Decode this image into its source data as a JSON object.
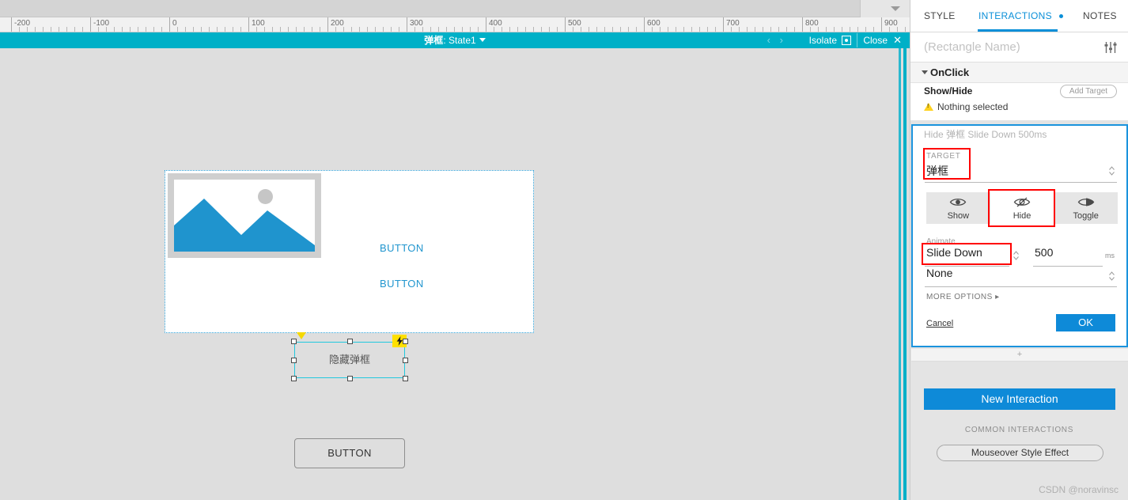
{
  "canvas_toolbar": {
    "ruler_labels": [
      "-200",
      "-100",
      "0",
      "100",
      "200",
      "300",
      "400",
      "500",
      "600",
      "700",
      "800",
      "900"
    ],
    "collapse_icon": "chevron-down-icon"
  },
  "isolate_bar": {
    "widget_name": "弹框",
    "state_separator": ": ",
    "state_name": "State1",
    "prev": "‹",
    "next": "›",
    "isolate_label": "Isolate",
    "close_label": "Close",
    "close_x": "✕"
  },
  "canvas": {
    "dialog": {
      "links": [
        "BUTTON",
        "BUTTON"
      ],
      "image_placeholder_icon": "image-placeholder-icon"
    },
    "selected_shape": {
      "label": "隐藏弹框",
      "bolt_icon": "lightning-bolt-icon",
      "rotate_icon": "rotate-handle-icon"
    },
    "bottom_button": {
      "label": "BUTTON"
    }
  },
  "right_panel": {
    "tabs": [
      {
        "label": "STYLE",
        "active": false
      },
      {
        "label": "INTERACTIONS",
        "active": true,
        "has_dot": true
      },
      {
        "label": "NOTES",
        "active": false
      }
    ],
    "name_field": {
      "placeholder": "(Rectangle Name)",
      "sliders_icon": "sliders-icon"
    },
    "event": {
      "caret": "chevron-down-icon",
      "label": "OnClick"
    },
    "action": {
      "label": "Show/Hide",
      "add_target_label": "Add Target",
      "warning_icon": "warning-icon",
      "warning_text": "Nothing selected"
    },
    "editor_card": {
      "summary": "Hide 弹框 Slide Down 500ms",
      "target_label": "TARGET",
      "target_value": "弹框",
      "visibility_options": [
        {
          "label": "Show",
          "icon": "eye-open-icon",
          "active": false
        },
        {
          "label": "Hide",
          "icon": "eye-slash-icon",
          "active": true
        },
        {
          "label": "Toggle",
          "icon": "eye-half-icon",
          "active": false
        }
      ],
      "animate_label": "Animate",
      "animate_value": "Slide Down",
      "duration_value": "500",
      "duration_unit": "ms",
      "easing_value": "None",
      "more_options_label": "MORE OPTIONS",
      "more_options_caret": "▸",
      "cancel_label": "Cancel",
      "ok_label": "OK"
    },
    "add_action_plus": "+",
    "new_interaction_label": "New Interaction",
    "common_interactions_label": "COMMON INTERACTIONS",
    "common_interactions": [
      "Mouseover Style Effect"
    ]
  },
  "watermark": "CSDN @noravinsc",
  "colors": {
    "accent_blue": "#0e8ad8",
    "isolate_teal": "#00b0c7",
    "selection_cyan": "#22c8de",
    "highlight_red": "#ff0000",
    "bolt_yellow": "#ffe000",
    "canvas_gray": "#dedede"
  }
}
